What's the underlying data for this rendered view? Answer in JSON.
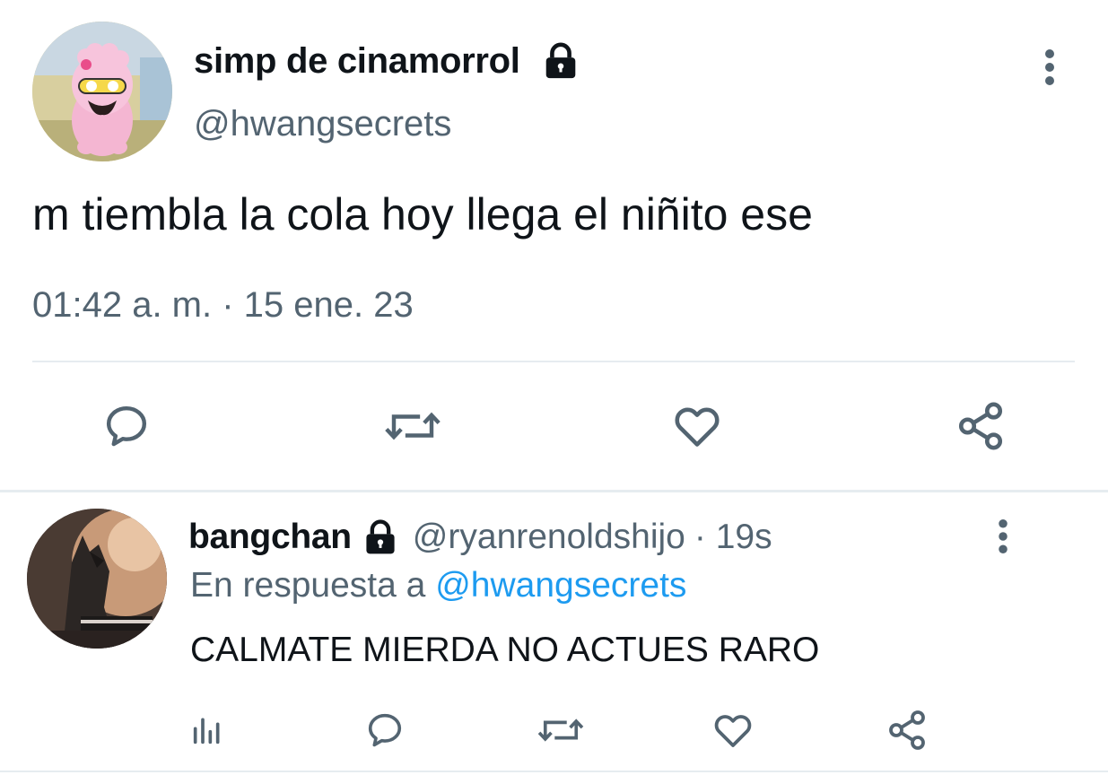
{
  "main_tweet": {
    "display_name": "simp de cinamorrol",
    "handle": "@hwangsecrets",
    "text": "m tiembla la cola hoy llega el niñito ese",
    "timestamp": "01:42 a. m. · 15 ene. 23",
    "locked": true,
    "actions": [
      "reply-icon",
      "retweet-icon",
      "like-icon",
      "share-icon"
    ]
  },
  "reply_tweet": {
    "display_name": "bangchan",
    "handle": "@ryanrenoldshijo",
    "time_ago": "· 19s",
    "replying_prefix": "En respuesta a",
    "replying_handle": "@hwangsecrets",
    "text": "CALMATE MIERDA NO ACTUES RARO",
    "locked": true,
    "actions": [
      "analytics-icon",
      "reply-icon",
      "retweet-icon",
      "like-icon",
      "share-icon"
    ]
  },
  "colors": {
    "text": "#0f1419",
    "muted": "#536471",
    "link": "#1d9bf0",
    "divider": "#e6ecf0"
  }
}
